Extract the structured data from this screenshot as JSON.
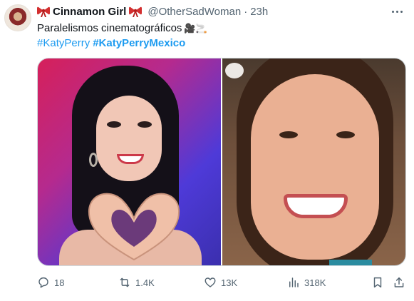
{
  "author": {
    "display_name": "Cinnamon Girl",
    "handle": "@OtherSadWoman",
    "separator": "·",
    "time": "23h"
  },
  "tweet": {
    "text": "Paralelismos cinematográficos",
    "text_emoji": "🎥🚬",
    "hashtags": [
      "#KatyPerry",
      "#KatyPerryMexico"
    ]
  },
  "actions": {
    "replies": "18",
    "retweets": "1.4K",
    "likes": "13K",
    "views": "318K"
  },
  "icons": {
    "reply": "reply-icon",
    "retweet": "retweet-icon",
    "like": "heart-icon",
    "views": "views-icon",
    "bookmark": "bookmark-icon",
    "share": "share-icon",
    "more": "more-icon",
    "bow": "ribbon-bow-icon"
  },
  "colors": {
    "hashtag": "#1d9bf0",
    "secondary_text": "#536471",
    "bow": "#d32f2f"
  }
}
